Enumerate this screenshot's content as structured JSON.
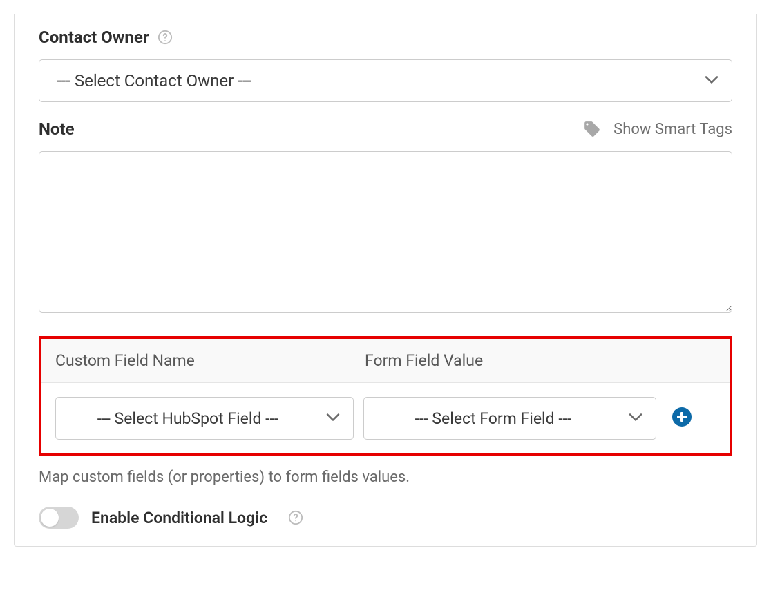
{
  "contact_owner": {
    "label": "Contact Owner",
    "placeholder": "--- Select Contact Owner ---"
  },
  "note": {
    "label": "Note",
    "smart_tags_label": "Show Smart Tags"
  },
  "mapping": {
    "header_name": "Custom Field Name",
    "header_value": "Form Field Value",
    "select_hubspot_placeholder": "--- Select HubSpot Field ---",
    "select_form_placeholder": "--- Select Form Field ---"
  },
  "helper_text": "Map custom fields (or properties) to form fields values.",
  "conditional_logic": {
    "label": "Enable Conditional Logic"
  }
}
